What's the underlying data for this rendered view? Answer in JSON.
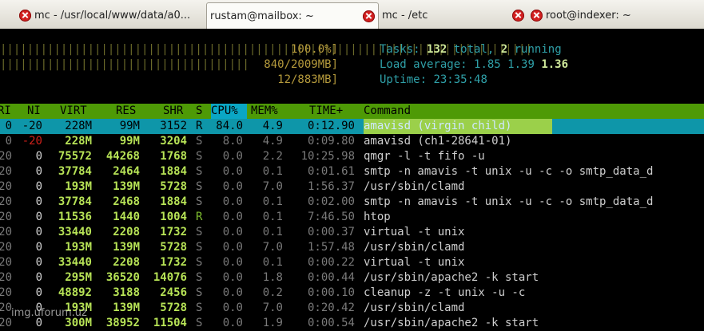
{
  "tabs": [
    {
      "label": "mc - /usr/local/www/data/a0...",
      "active": false
    },
    {
      "label": "rustam@mailbox: ~",
      "active": true
    },
    {
      "label": "mc - /etc",
      "active": false
    },
    {
      "label": "root@indexer: ~",
      "active": false
    }
  ],
  "meters": {
    "cpu_bar": "|||||||||||||||||||||||||||||||||||||||||||||||||||||||||||||||||||||||||||||||",
    "cpu_value": "100.0%]",
    "mem_bar": "|||||||||||||||||||||||||||||||||||||||||||||||||||||||||||",
    "mem_value": "840/2009MB]",
    "swap_value": "12/883MB]"
  },
  "summary": {
    "tasks_label": "Tasks: ",
    "tasks_total": "132",
    "tasks_mid": " total, ",
    "tasks_running": "2",
    "tasks_end": " running",
    "load_label": "Load average: ",
    "load_1": "1.85",
    "load_5": "1.39",
    "load_15": "1.36",
    "uptime_label": "Uptime: ",
    "uptime_value": "23:35:48"
  },
  "header": {
    "pri": "RI",
    "ni": "NI",
    "virt": "VIRT",
    "res": "RES",
    "shr": "SHR",
    "s": "S",
    "cpu": "CPU%",
    "mem": "MEM%",
    "time": "TIME+",
    "command": "Command"
  },
  "processes": [
    {
      "pri": "0",
      "ni": "-20",
      "virt": "228M",
      "res": "99M",
      "shr": "3152",
      "s": "R",
      "cpu": "84.0",
      "mem": "4.9",
      "time": "0:12.90",
      "command": "amavisd (virgin child)"
    },
    {
      "pri": "0",
      "ni": "-20",
      "virt": "228M",
      "res": "99M",
      "shr": "3204",
      "s": "S",
      "cpu": "8.0",
      "mem": "4.9",
      "time": "0:09.80",
      "command": "amavisd (ch1-28641-01)"
    },
    {
      "pri": "20",
      "ni": "0",
      "virt": "75572",
      "res": "44268",
      "shr": "1768",
      "s": "S",
      "cpu": "0.0",
      "mem": "2.2",
      "time": "10:25.98",
      "command": "qmgr -l -t fifo -u"
    },
    {
      "pri": "20",
      "ni": "0",
      "virt": "37784",
      "res": "2464",
      "shr": "1884",
      "s": "S",
      "cpu": "0.0",
      "mem": "0.1",
      "time": "0:01.61",
      "command": "smtp -n amavis -t unix -u -c -o smtp_data_d"
    },
    {
      "pri": "20",
      "ni": "0",
      "virt": "193M",
      "res": "139M",
      "shr": "5728",
      "s": "S",
      "cpu": "0.0",
      "mem": "7.0",
      "time": "1:56.37",
      "command": "/usr/sbin/clamd"
    },
    {
      "pri": "20",
      "ni": "0",
      "virt": "37784",
      "res": "2468",
      "shr": "1884",
      "s": "S",
      "cpu": "0.0",
      "mem": "0.1",
      "time": "0:02.00",
      "command": "smtp -n amavis -t unix -u -c -o smtp_data_d"
    },
    {
      "pri": "20",
      "ni": "0",
      "virt": "11536",
      "res": "1440",
      "shr": "1004",
      "s": "R",
      "cpu": "0.0",
      "mem": "0.1",
      "time": "7:46.50",
      "command": "htop"
    },
    {
      "pri": "20",
      "ni": "0",
      "virt": "33440",
      "res": "2208",
      "shr": "1732",
      "s": "S",
      "cpu": "0.0",
      "mem": "0.1",
      "time": "0:00.37",
      "command": "virtual -t unix"
    },
    {
      "pri": "20",
      "ni": "0",
      "virt": "193M",
      "res": "139M",
      "shr": "5728",
      "s": "S",
      "cpu": "0.0",
      "mem": "7.0",
      "time": "1:57.48",
      "command": "/usr/sbin/clamd"
    },
    {
      "pri": "20",
      "ni": "0",
      "virt": "33440",
      "res": "2208",
      "shr": "1732",
      "s": "S",
      "cpu": "0.0",
      "mem": "0.1",
      "time": "0:00.22",
      "command": "virtual -t unix"
    },
    {
      "pri": "20",
      "ni": "0",
      "virt": "295M",
      "res": "36520",
      "shr": "14076",
      "s": "S",
      "cpu": "0.0",
      "mem": "1.8",
      "time": "0:00.44",
      "command": "/usr/sbin/apache2 -k start"
    },
    {
      "pri": "20",
      "ni": "0",
      "virt": "48892",
      "res": "3188",
      "shr": "2456",
      "s": "S",
      "cpu": "0.0",
      "mem": "0.2",
      "time": "0:00.10",
      "command": "cleanup -z -t unix -u -c"
    },
    {
      "pri": "20",
      "ni": "0",
      "virt": "193M",
      "res": "139M",
      "shr": "5728",
      "s": "S",
      "cpu": "0.0",
      "mem": "7.0",
      "time": "0:20.42",
      "command": "/usr/sbin/clamd"
    },
    {
      "pri": "20",
      "ni": "0",
      "virt": "300M",
      "res": "38952",
      "shr": "11504",
      "s": "S",
      "cpu": "0.0",
      "mem": "1.9",
      "time": "0:00.54",
      "command": "/usr/sbin/apache2 -k start"
    }
  ],
  "watermark": "img.uforum.uz",
  "colors": {
    "tab_close": "#d21f1f",
    "header_bg": "#4e9a06",
    "selected_row": "#0e96a9",
    "sort_column": "#0aa6c4"
  }
}
